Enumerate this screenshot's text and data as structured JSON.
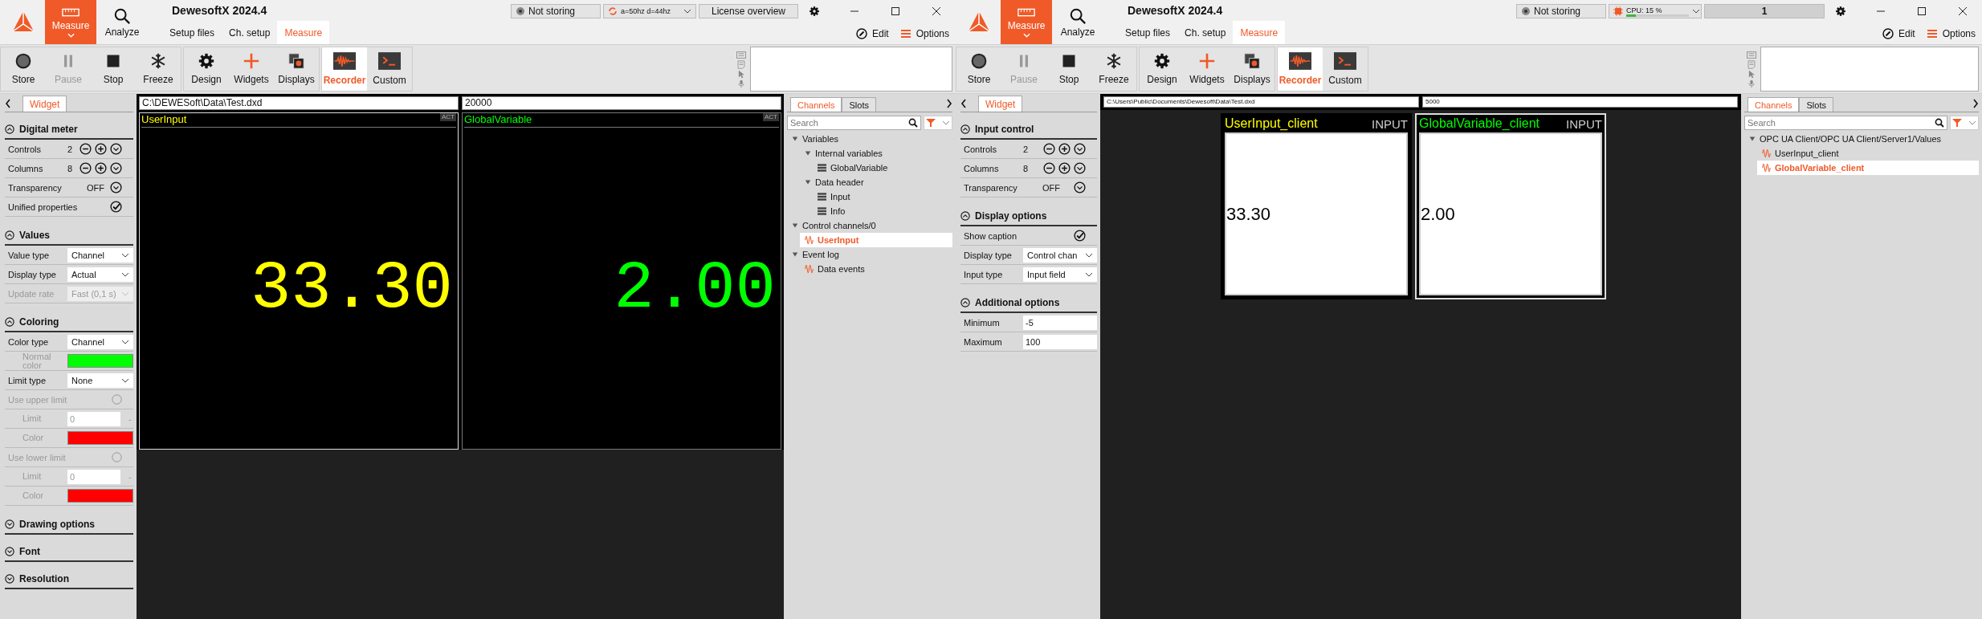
{
  "windows": [
    {
      "title": "DewesoftX 2024.4",
      "modes": [
        {
          "label": "Measure",
          "selected": true
        },
        {
          "label": "Analyze",
          "selected": false
        }
      ],
      "tabs": [
        {
          "label": "Setup files",
          "selected": false
        },
        {
          "label": "Ch. setup",
          "selected": false
        },
        {
          "label": "Measure",
          "selected": true
        }
      ],
      "status": [
        {
          "kind": "storage",
          "text": "Not storing"
        },
        {
          "kind": "sync",
          "text": "a=50hz d=44hz"
        },
        {
          "kind": "button",
          "text": "License overview"
        }
      ],
      "edit": "Edit",
      "options": "Options",
      "toolbar": [
        [
          {
            "label": "Store",
            "disabled": false,
            "selected": false
          },
          {
            "label": "Pause",
            "disabled": true,
            "selected": false
          },
          {
            "label": "Stop",
            "disabled": false,
            "selected": false
          },
          {
            "label": "Freeze",
            "disabled": false,
            "selected": false
          }
        ],
        [
          {
            "label": "Design",
            "disabled": false,
            "selected": false
          },
          {
            "label": "Widgets",
            "disabled": false,
            "selected": false
          },
          {
            "label": "Displays",
            "disabled": false,
            "selected": false
          }
        ],
        [
          {
            "label": "Recorder",
            "disabled": false,
            "selected": true
          },
          {
            "label": "Custom",
            "disabled": false,
            "selected": false
          }
        ]
      ],
      "panel_tab": "Widget",
      "sections": [
        {
          "title": "Digital meter",
          "expanded": true,
          "rows": [
            {
              "kind": "stepper",
              "label": "Controls",
              "value": "2"
            },
            {
              "kind": "stepper",
              "label": "Columns",
              "value": "8"
            },
            {
              "kind": "toggle",
              "label": "Transparency",
              "value": "OFF"
            },
            {
              "kind": "check",
              "label": "Unified properties",
              "checked": true
            }
          ]
        },
        {
          "title": "Values",
          "expanded": true,
          "rows": [
            {
              "kind": "select",
              "label": "Value type",
              "value": "Channel",
              "disabled": false
            },
            {
              "kind": "select",
              "label": "Display type",
              "value": "Actual",
              "disabled": false
            },
            {
              "kind": "select",
              "label": "Update rate",
              "value": "Fast (0,1 s)",
              "disabled": true
            }
          ]
        },
        {
          "title": "Coloring",
          "expanded": true,
          "rows": [
            {
              "kind": "select",
              "label": "Color type",
              "value": "Channel",
              "disabled": false
            },
            {
              "kind": "color",
              "label": "Normal color",
              "color": "#00ff00",
              "disabled": true
            },
            {
              "kind": "select",
              "label": "Limit type",
              "value": "None",
              "disabled": false
            },
            {
              "kind": "radio",
              "label": "Use upper limit",
              "checked": false,
              "disabled": true
            },
            {
              "kind": "input",
              "label": "Limit",
              "value": "0",
              "unit": "-",
              "disabled": true
            },
            {
              "kind": "color",
              "label": "Color",
              "color": "#ff0000",
              "disabled": true
            },
            {
              "kind": "radio",
              "label": "Use lower limit",
              "checked": false,
              "disabled": true
            },
            {
              "kind": "input",
              "label": "Limit",
              "value": "0",
              "unit": "-",
              "disabled": true
            },
            {
              "kind": "color",
              "label": "Color",
              "color": "#ff0000",
              "disabled": true
            }
          ]
        },
        {
          "title": "Drawing options",
          "expanded": false
        },
        {
          "title": "Font",
          "expanded": false
        },
        {
          "title": "Resolution",
          "expanded": false
        }
      ],
      "paths": [
        "C:\\DEWESoft\\Data\\Test.dxd",
        "20000"
      ],
      "widgets": [
        {
          "kind": "meter",
          "name": "UserInput",
          "badge": "ACT",
          "value": "33.30",
          "color": "#ffff00",
          "selected": true
        },
        {
          "kind": "meter",
          "name": "GlobalVariable",
          "badge": "ACT",
          "value": "2.00",
          "color": "#00ff00",
          "selected": false
        }
      ],
      "channel_tabs": [
        {
          "label": "Channels",
          "selected": true
        },
        {
          "label": "Slots",
          "selected": false
        }
      ],
      "search_placeholder": "Search",
      "tree": [
        {
          "label": "Variables",
          "kind": "group",
          "expanded": true,
          "selected": false,
          "children": [
            {
              "label": "Internal variables",
              "kind": "group",
              "expanded": true,
              "selected": false,
              "children": [
                {
                  "label": "GlobalVariable",
                  "kind": "variable",
                  "selected": false
                }
              ]
            },
            {
              "label": "Data header",
              "kind": "group",
              "expanded": true,
              "selected": false,
              "children": [
                {
                  "label": "Input",
                  "kind": "variable",
                  "selected": false
                },
                {
                  "label": "Info",
                  "kind": "variable",
                  "selected": false
                }
              ]
            }
          ]
        },
        {
          "label": "Control channels/0",
          "kind": "group",
          "expanded": true,
          "selected": false,
          "children": [
            {
              "label": "UserInput",
              "kind": "signal",
              "selected": true
            }
          ]
        },
        {
          "label": "Event log",
          "kind": "group",
          "expanded": true,
          "selected": false,
          "children": [
            {
              "label": "Data events",
              "kind": "signal",
              "selected": false
            }
          ]
        }
      ]
    },
    {
      "title": "DewesoftX 2024.4",
      "modes": [
        {
          "label": "Measure",
          "selected": true
        },
        {
          "label": "Analyze",
          "selected": false
        }
      ],
      "tabs": [
        {
          "label": "Setup files",
          "selected": false
        },
        {
          "label": "Ch. setup",
          "selected": false
        },
        {
          "label": "Measure",
          "selected": true
        }
      ],
      "status": [
        {
          "kind": "storage",
          "text": "Not storing"
        },
        {
          "kind": "cpu",
          "text": "CPU: 15 %",
          "level": 0.15
        },
        {
          "kind": "button",
          "text": "1"
        }
      ],
      "edit": "Edit",
      "options": "Options",
      "toolbar": [
        [
          {
            "label": "Store",
            "disabled": false,
            "selected": false
          },
          {
            "label": "Pause",
            "disabled": true,
            "selected": false
          },
          {
            "label": "Stop",
            "disabled": false,
            "selected": false
          },
          {
            "label": "Freeze",
            "disabled": false,
            "selected": false
          }
        ],
        [
          {
            "label": "Design",
            "disabled": false,
            "selected": false
          },
          {
            "label": "Widgets",
            "disabled": false,
            "selected": false
          },
          {
            "label": "Displays",
            "disabled": false,
            "selected": false
          }
        ],
        [
          {
            "label": "Recorder",
            "disabled": false,
            "selected": true
          },
          {
            "label": "Custom",
            "disabled": false,
            "selected": false
          }
        ]
      ],
      "panel_tab": "Widget",
      "sections": [
        {
          "title": "Input control",
          "expanded": true,
          "rows": [
            {
              "kind": "stepper",
              "label": "Controls",
              "value": "2"
            },
            {
              "kind": "stepper",
              "label": "Columns",
              "value": "8"
            },
            {
              "kind": "toggle",
              "label": "Transparency",
              "value": "OFF"
            }
          ]
        },
        {
          "title": "Display options",
          "expanded": true,
          "rows": [
            {
              "kind": "check",
              "label": "Show caption",
              "checked": true
            },
            {
              "kind": "select",
              "label": "Display type",
              "value": "Control chan",
              "disabled": false
            },
            {
              "kind": "select",
              "label": "Input type",
              "value": "Input field",
              "disabled": false
            }
          ]
        },
        {
          "title": "Additional options",
          "expanded": true,
          "rows": [
            {
              "kind": "input",
              "label": "Minimum",
              "value": "-5",
              "disabled": false
            },
            {
              "kind": "input",
              "label": "Maximum",
              "value": "100",
              "disabled": false
            }
          ]
        }
      ],
      "paths": [
        "C:\\Users\\Public\\Documents\\Dewesoft\\Data\\Test.dxd",
        "5000"
      ],
      "widgets": [
        {
          "kind": "input",
          "name": "UserInput_client",
          "badge": "INPUT",
          "value": "33.30",
          "color": "#ffff00",
          "selected": false
        },
        {
          "kind": "input",
          "name": "GlobalVariable_client",
          "badge": "INPUT",
          "value": "2.00",
          "color": "#00ff00",
          "selected": true
        }
      ],
      "channel_tabs": [
        {
          "label": "Channels",
          "selected": true
        },
        {
          "label": "Slots",
          "selected": false
        }
      ],
      "search_placeholder": "Search",
      "tree": [
        {
          "label": "OPC UA Client/OPC UA Client/Server1/Values",
          "kind": "group",
          "expanded": true,
          "selected": false,
          "children": [
            {
              "label": "UserInput_client",
              "kind": "signal",
              "selected": false
            },
            {
              "label": "GlobalVariable_client",
              "kind": "signal",
              "selected": true
            }
          ]
        }
      ]
    }
  ]
}
